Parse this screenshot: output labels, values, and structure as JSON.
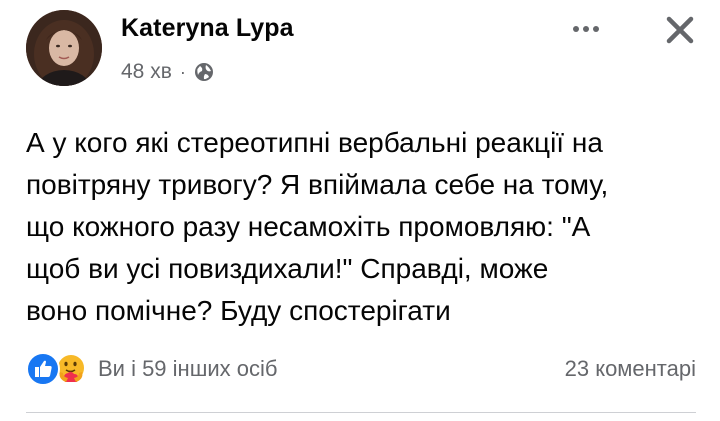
{
  "post": {
    "author": "Kateryna Lypa",
    "time": "48 хв",
    "separator": "·",
    "audience_icon": "globe-icon",
    "text": "А у кого які стереотипні вербальні реакції на\nповітряну тривогу? Я впіймала себе на тому,\nщо кожного разу несамохіть промовляю: \"А\nщоб ви усі повиздихали!\" Справді, може\nвоно помічне? Буду спостерігати"
  },
  "header": {
    "more_icon": "more-horizontal-icon",
    "close_icon": "close-icon"
  },
  "footer": {
    "reaction_icons": [
      "like-icon",
      "care-icon"
    ],
    "reactions_text": "Ви і 59 інших осіб",
    "comments_text": "23 коментарі"
  },
  "colors": {
    "text": "#050505",
    "secondary": "#65676b",
    "like_blue": "#1877f2",
    "care_yellow": "#f7b928",
    "divider": "#ced0d4"
  }
}
